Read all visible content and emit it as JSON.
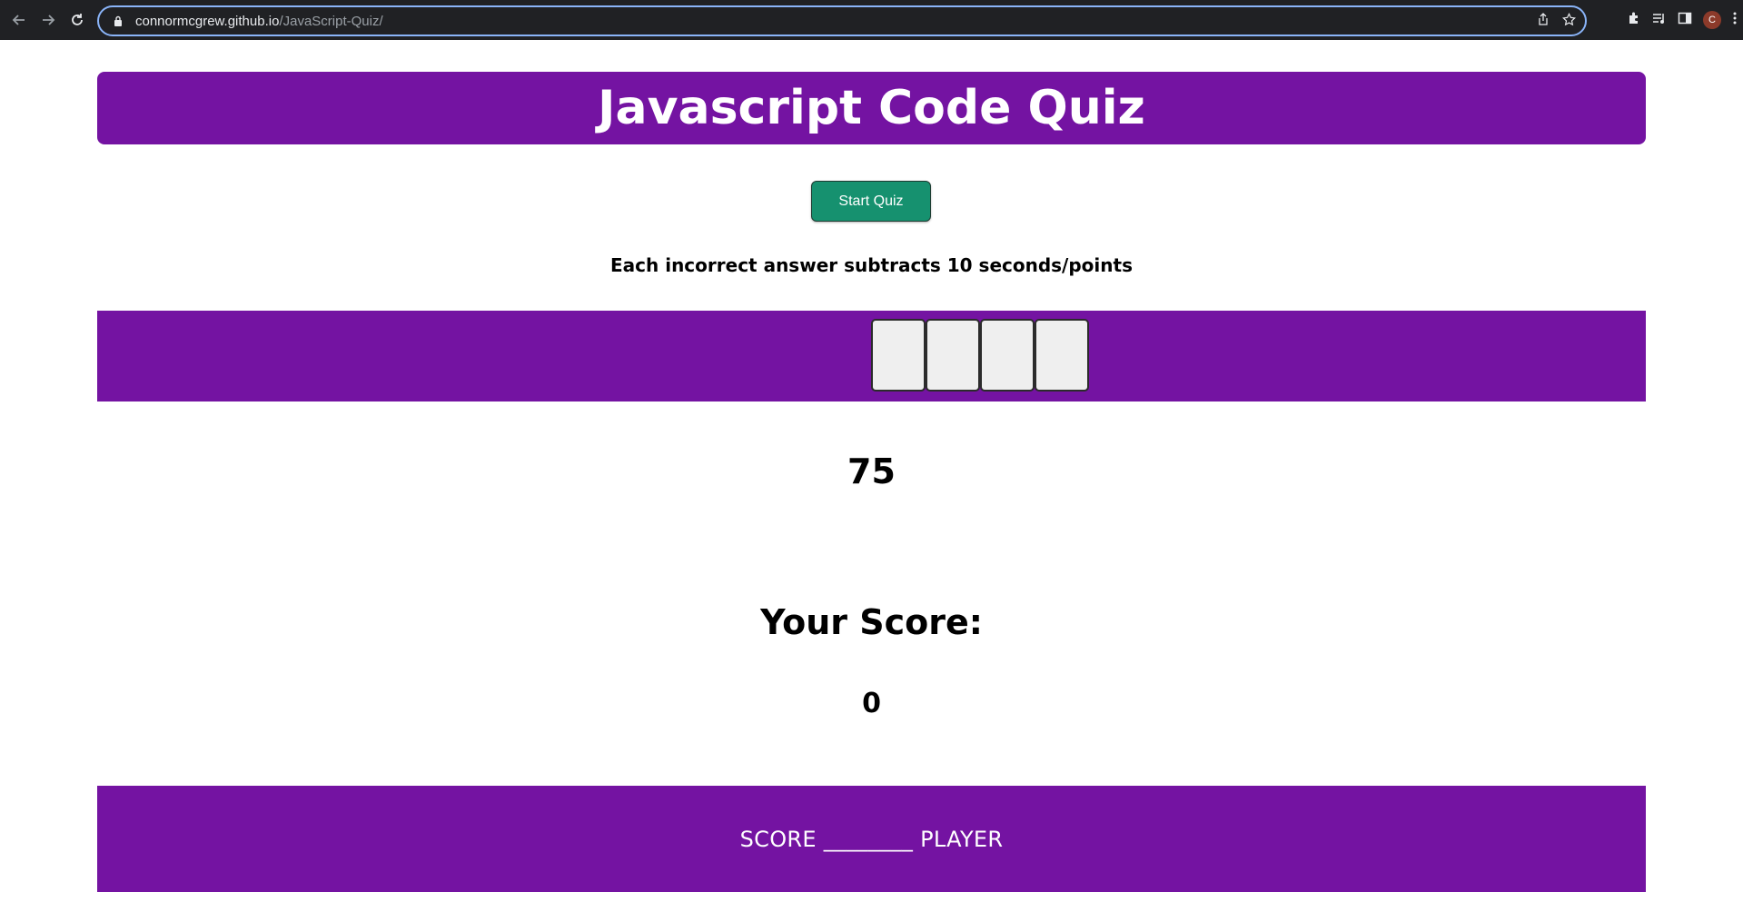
{
  "browser": {
    "url_host": "connormcgrew.github.io",
    "url_path": "/JavaScript-Quiz/",
    "avatar_initial": "C",
    "icons": [
      "back-icon",
      "forward-icon",
      "reload-icon",
      "lock-icon",
      "share-icon",
      "star-icon",
      "extensions-icon",
      "media-icon",
      "sidepanel-icon",
      "menu-icon"
    ]
  },
  "page": {
    "title": "Javascript Code Quiz",
    "start_button": "Start Quiz",
    "info": "Each incorrect answer subtracts 10 seconds/points",
    "answers": [
      "",
      "",
      "",
      ""
    ],
    "timer": "75",
    "score_heading": "Your Score:",
    "score_value": "0",
    "footer": "SCORE ________ PLAYER"
  },
  "colors": {
    "accent": "#7413a2",
    "button": "#16916f",
    "answer_button": "#efefef"
  }
}
